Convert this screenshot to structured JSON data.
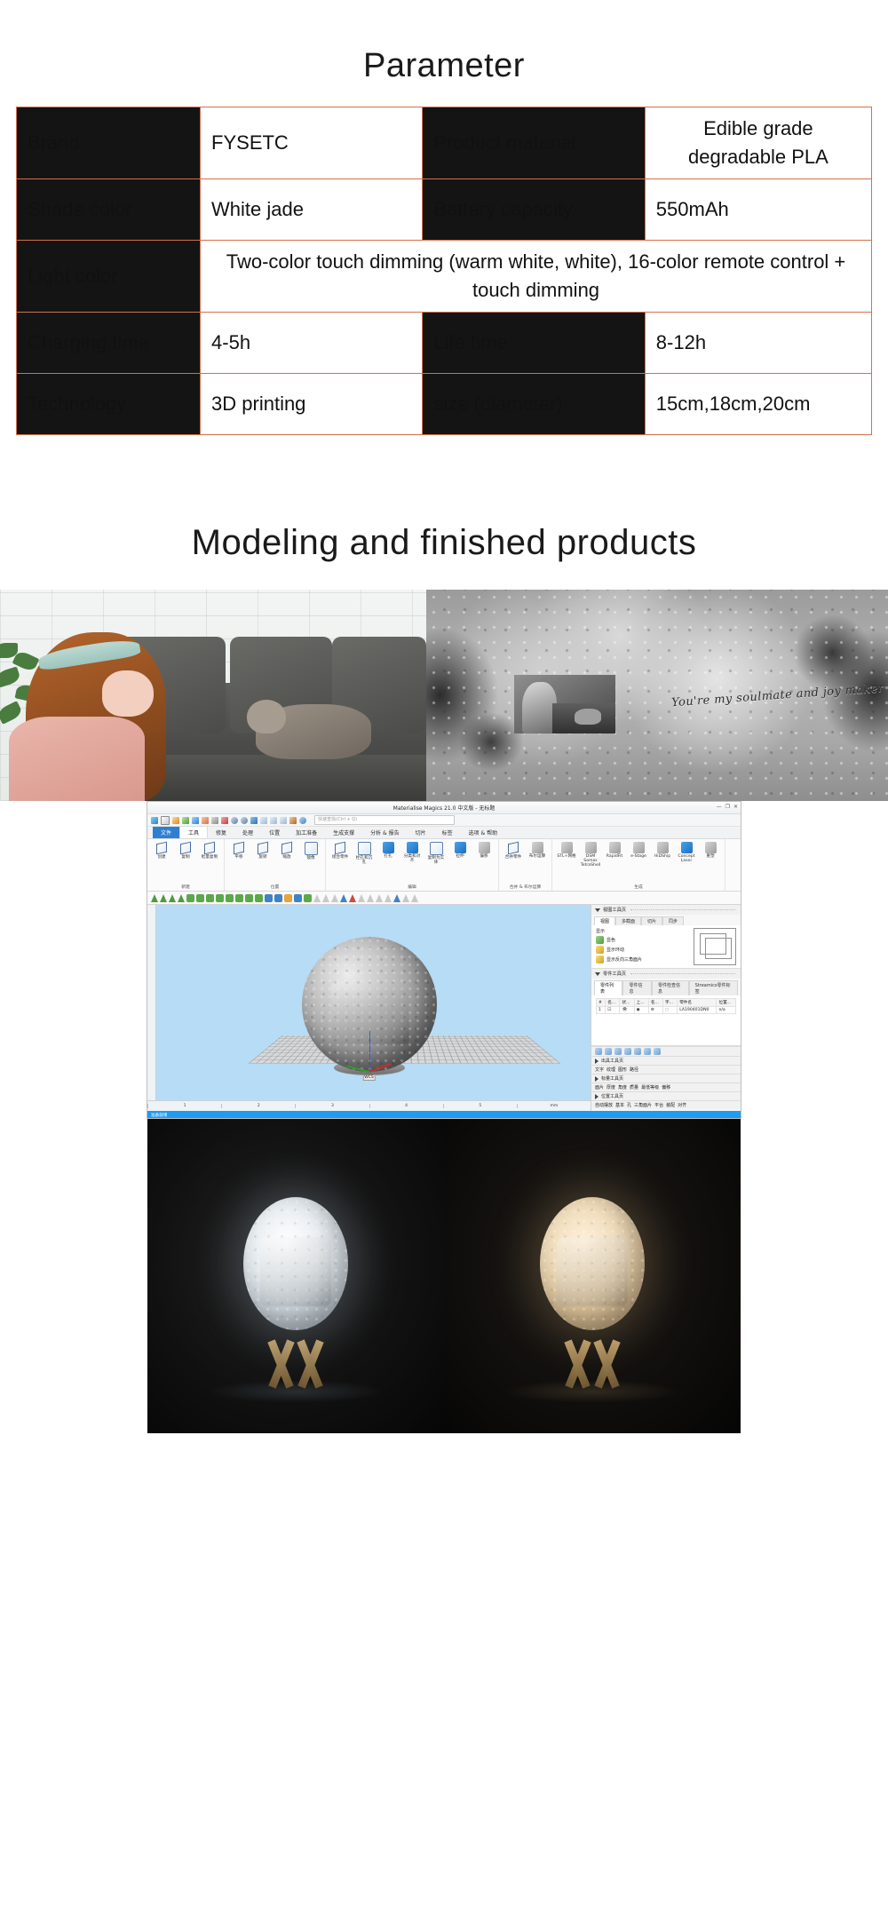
{
  "parameter_section": {
    "title": "Parameter",
    "table": {
      "rows": [
        [
          {
            "type": "key",
            "text": "Brand"
          },
          {
            "type": "value",
            "text": "FYSETC"
          },
          {
            "type": "key",
            "text": "Product material"
          },
          {
            "type": "value",
            "text": "Edible grade degradable PLA"
          }
        ],
        [
          {
            "type": "key",
            "text": "Shade color"
          },
          {
            "type": "value",
            "text": "White jade"
          },
          {
            "type": "key",
            "text": "Battery capacity"
          },
          {
            "type": "value",
            "text": "550mAh"
          }
        ],
        [
          {
            "type": "key",
            "text": "Light color"
          },
          {
            "type": "value",
            "text": "Two-color touch dimming (warm white, white), 16-color remote control + touch dimming",
            "span": 3
          }
        ],
        [
          {
            "type": "key",
            "text": "Charging time"
          },
          {
            "type": "value",
            "text": "4-5h"
          },
          {
            "type": "key",
            "text": "Life time"
          },
          {
            "type": "value",
            "text": "8-12h"
          }
        ],
        [
          {
            "type": "key",
            "text": "Technology"
          },
          {
            "type": "value",
            "text": "3D printing"
          },
          {
            "type": "key",
            "text": "size (diameter)"
          },
          {
            "type": "value",
            "text": "15cm,18cm,20cm"
          }
        ]
      ],
      "border_color": "#d2714b",
      "key_background": "#141414",
      "key_text_color": "#ffffff"
    }
  },
  "modeling_section": {
    "title": "Modeling and finished products",
    "photo_couple": {
      "caption": "woman with cat on sofa photo"
    },
    "moon_texture_map": {
      "engraved_text": "You're my soulmate and joy maker",
      "caption": "equirectangular moon surface texture map with embedded photo"
    }
  },
  "software": {
    "window_title": "Materialise Magics 21.0 中文版 - 无标题",
    "window_buttons": [
      "—",
      "❐",
      "✕"
    ],
    "quick_access_icons": [
      "open-icon",
      "new-icon",
      "save-icon",
      "save-as-icon",
      "import-icon",
      "export-icon",
      "print-icon",
      "delete-icon",
      "undo-icon",
      "redo-icon",
      "select-icon",
      "zoom-in-icon",
      "zoom-fit-icon",
      "zoom-window-icon",
      "measure-icon",
      "search-icon"
    ],
    "search_placeholder": "快速查找(Ctrl + Q)",
    "ribbon_tabs": [
      {
        "label": "文件",
        "state": "blue"
      },
      {
        "label": "工具",
        "state": "active"
      },
      {
        "label": "修复",
        "state": "normal"
      },
      {
        "label": "处理",
        "state": "normal"
      },
      {
        "label": "位置",
        "state": "normal"
      },
      {
        "label": "加工准备",
        "state": "normal"
      },
      {
        "label": "生成支撑",
        "state": "normal"
      },
      {
        "label": "分析 & 报告",
        "state": "normal"
      },
      {
        "label": "切片",
        "state": "normal"
      },
      {
        "label": "标签",
        "state": "normal"
      },
      {
        "label": "选项 & 帮助",
        "state": "normal"
      }
    ],
    "ribbon_groups": [
      {
        "title": "新建",
        "items": [
          {
            "label": "创建",
            "icon": "cube-create-icon"
          },
          {
            "label": "复制",
            "icon": "cube-copy-icon"
          },
          {
            "label": "批量复制",
            "icon": "cube-array-icon"
          }
        ]
      },
      {
        "title": "位置",
        "items": [
          {
            "label": "平移",
            "icon": "translate-icon"
          },
          {
            "label": "旋转",
            "icon": "rotate-icon"
          },
          {
            "label": "缩放",
            "icon": "scale-icon"
          },
          {
            "label": "镜像",
            "icon": "mirror-icon"
          }
        ]
      },
      {
        "title": "编辑",
        "items": [
          {
            "label": "组合零件",
            "icon": "boolean-icon"
          },
          {
            "label": "栓孔和沉孔",
            "icon": "hole-icon"
          },
          {
            "label": "打孔",
            "icon": "punch-icon"
          },
          {
            "label": "分类和对齐",
            "icon": "align-icon"
          },
          {
            "label": "复制为实体",
            "icon": "solid-icon"
          },
          {
            "label": "拉伸",
            "icon": "extrude-icon"
          },
          {
            "label": "偏移",
            "icon": "offset-icon"
          }
        ]
      },
      {
        "title": "合并 & 布尔运算",
        "items": [
          {
            "label": "合并零件",
            "icon": "merge-icon"
          },
          {
            "label": "布尔运算",
            "icon": "bool-op-icon"
          }
        ]
      },
      {
        "title": "生成",
        "items": [
          {
            "label": "STL+网格",
            "icon": "stl-icon"
          },
          {
            "label": "DSM Somos TetraShell",
            "icon": "tetrashell-icon"
          },
          {
            "label": "RapidFit",
            "icon": "rapidfit-icon"
          },
          {
            "label": "e-Stage",
            "icon": "estage-icon"
          },
          {
            "label": "HiDShip",
            "icon": "hidship-icon"
          },
          {
            "label": "Concept Laser",
            "icon": "conceptlaser-icon"
          },
          {
            "label": "重塑",
            "icon": "reshape-icon"
          }
        ]
      }
    ],
    "panels": [
      {
        "title": "视图工具页",
        "tabs": [
          "视图",
          "多截面",
          "切片",
          "同步"
        ],
        "section_label": "显示",
        "options": [
          {
            "label": "显色",
            "icon": "shade-icon"
          },
          {
            "label": "显示环动",
            "icon": "triangle-icon"
          },
          {
            "label": "显示反向三角面片",
            "icon": "inverted-triangle-icon"
          }
        ],
        "preview": "wireframe-cube-icon"
      },
      {
        "title": "零件工具页",
        "tabs": [
          "零件列表",
          "零件信息",
          "零件检查信息",
          "Streamics零件标签"
        ],
        "table": {
          "headers": [
            "#",
            "名...",
            "状...",
            "上...",
            "名...",
            "字...",
            "零件名",
            "位置..."
          ],
          "rows": [
            [
              "1",
              "☑",
              "👁",
              "◉",
              "⚙",
              "◌",
              "LA190401DN0",
              "n/a"
            ]
          ]
        }
      }
    ],
    "bottom_strips": [
      {
        "title": "出具工具页",
        "items": [
          "文字",
          "纹理",
          "图形",
          "路径"
        ]
      },
      {
        "title": "标量工具页",
        "items": [
          "面片",
          "厚度",
          "角度",
          "质量",
          "最低等级",
          "偏移"
        ]
      },
      {
        "title": "位置工具页",
        "items": [
          "自动摆放",
          "基本",
          "孔",
          "三角面片",
          "平台",
          "装配",
          "对齐"
        ]
      }
    ],
    "status_bar": "准备就绪",
    "ruler_ticks": [
      "1",
      "2",
      "3",
      "4",
      "5"
    ],
    "ruler_unit": "mm",
    "wcs_label": "WCS"
  },
  "final_photos": {
    "left": {
      "caption": "moon lamp lit cool white on wooden stand",
      "light_mode": "white"
    },
    "right": {
      "caption": "moon lamp lit warm white on wooden stand",
      "light_mode": "warm white"
    }
  }
}
